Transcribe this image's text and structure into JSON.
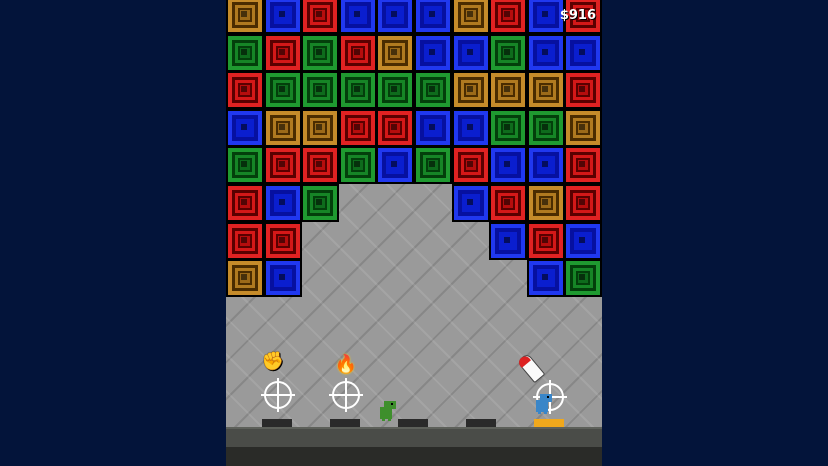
{
  "hud": {
    "money": "$916"
  },
  "colors": {
    "background": "#03143a",
    "red": "#b50d0d",
    "green": "#0e6b1c",
    "blue": "#0a1ecf",
    "orange": "#9c6a19",
    "active_pad": "#f0a81c"
  },
  "board": {
    "columns": 10,
    "rows": [
      [
        "orange",
        "blue",
        "red",
        "blue",
        "blue",
        "blue",
        "orange",
        "red",
        "blue",
        "red"
      ],
      [
        "green",
        "red",
        "green",
        "red",
        "orange",
        "blue",
        "blue",
        "green",
        "blue",
        "blue"
      ],
      [
        "red",
        "green",
        "green",
        "green",
        "green",
        "green",
        "orange",
        "orange",
        "orange",
        "red"
      ],
      [
        "blue",
        "orange",
        "orange",
        "red",
        "red",
        "blue",
        "blue",
        "green",
        "green",
        "orange"
      ],
      [
        "green",
        "red",
        "red",
        "green",
        "blue",
        "green",
        "red",
        "blue",
        "blue",
        "red"
      ],
      [
        "red",
        "blue",
        "green",
        null,
        null,
        null,
        "blue",
        "red",
        "orange",
        "red"
      ],
      [
        "red",
        "red",
        null,
        null,
        null,
        null,
        null,
        "blue",
        "red",
        "blue"
      ],
      [
        "orange",
        "blue",
        null,
        null,
        null,
        null,
        null,
        null,
        "blue",
        "green"
      ]
    ]
  },
  "launchers": [
    {
      "name": "fist-launcher",
      "powerup": "fist-icon",
      "glyph": "✊",
      "active": false
    },
    {
      "name": "fire-launcher",
      "powerup": "flame-icon",
      "glyph": "🔥",
      "active": false
    },
    {
      "name": "empty-launcher-3",
      "powerup": "",
      "active": false
    },
    {
      "name": "empty-launcher-4",
      "powerup": "",
      "active": false
    },
    {
      "name": "rocket-launcher",
      "powerup": "rocket-icon",
      "active": true
    }
  ],
  "players": [
    {
      "name": "green-dino-player",
      "color": "#3e8f2c"
    },
    {
      "name": "blue-dino-player",
      "color": "#3a86c8"
    }
  ]
}
